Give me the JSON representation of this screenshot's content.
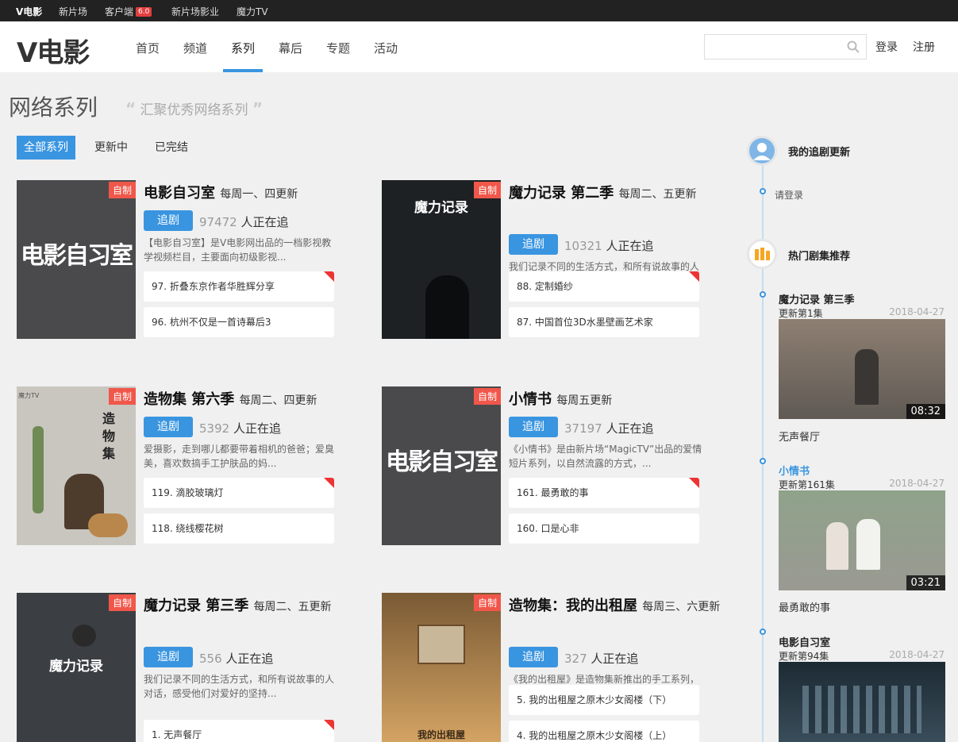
{
  "topbar": {
    "items": [
      "V电影",
      "新片场",
      "客户端",
      "新片场影业",
      "魔力TV"
    ],
    "client_badge": "6.0"
  },
  "header": {
    "logo": "V电影",
    "nav": [
      "首页",
      "频道",
      "系列",
      "幕后",
      "专题",
      "活动"
    ],
    "active_nav": "系列",
    "search_placeholder": "",
    "login": "登录",
    "register": "注册"
  },
  "page": {
    "title": "网络系列",
    "subtitle": "汇聚优秀网络系列",
    "filters": [
      "全部系列",
      "更新中",
      "已完结"
    ],
    "active_filter": "全部系列"
  },
  "cards": [
    {
      "tag": "自制",
      "title": "电影自习室",
      "schedule": "每周一、四更新",
      "follow_label": "追剧",
      "follow_count": "97472",
      "follow_suffix": "人正在追",
      "desc": "【电影自习室】是V电影网出品的一档影视教学视频栏目，主要面向初级影视...",
      "episodes": [
        "97. 折叠东京作者华胜辉分享",
        "96. 杭州不仅是一首诗幕后3"
      ],
      "thumb_label": "电影自习室",
      "thumb_bg": "#4a4a4c"
    },
    {
      "tag": "自制",
      "title": "魔力记录 第二季",
      "schedule": "每周二、五更新",
      "follow_label": "追剧",
      "follow_count": "10321",
      "follow_suffix": "人正在追",
      "desc": "我们记录不同的生活方式，和所有说故事的人",
      "episodes": [
        "88. 定制婚纱",
        "87. 中国首位3D水墨壁画艺术家"
      ],
      "thumb_label": "魔力记录",
      "thumb_bg": "#1d2124"
    },
    {
      "tag": "自制",
      "title": "造物集 第六季",
      "schedule": "每周二、四更新",
      "follow_label": "追剧",
      "follow_count": "5392",
      "follow_suffix": "人正在追",
      "desc": "爱摄影，走到哪儿都要带着相机的爸爸；爱臭美，喜欢数搞手工护肤品的妈...",
      "episodes": [
        "119. 滴胶玻璃灯",
        "118. 绕线樱花树"
      ],
      "thumb_label": "造物集",
      "thumb_bg": "#c9c6c0"
    },
    {
      "tag": "自制",
      "title": "小情书",
      "schedule": "每周五更新",
      "follow_label": "追剧",
      "follow_count": "37197",
      "follow_suffix": "人正在追",
      "desc": "《小情书》是由新片场“MagicTV”出品的爱情短片系列，以自然流露的方式，...",
      "episodes": [
        "161. 最勇敢的事",
        "160. 口是心非"
      ],
      "thumb_label": "电影自习室",
      "thumb_bg": "#4a4a4c"
    },
    {
      "tag": "自制",
      "title": "魔力记录 第三季",
      "schedule": "每周二、五更新",
      "follow_label": "追剧",
      "follow_count": "556",
      "follow_suffix": "人正在追",
      "desc": "我们记录不同的生活方式，和所有说故事的人对话，感受他们对爱好的坚持...",
      "episodes": [
        "1. 无声餐厅"
      ],
      "thumb_label": "魔力记录",
      "thumb_bg": "#3b3f44"
    },
    {
      "tag": "自制",
      "title": "造物集：我的出租屋",
      "schedule": "每周三、六更新",
      "follow_label": "追剧",
      "follow_count": "327",
      "follow_suffix": "人正在追",
      "desc": "《我的出租屋》是造物集新推出的手工系列，",
      "episodes": [
        "5. 我的出租屋之原木少女阁楼（下）",
        "4. 我的出租屋之原木少女阁楼（上）"
      ],
      "thumb_label": "我的出租屋",
      "thumb_bg": "#b6844c"
    }
  ],
  "sidebar": {
    "my_updates_title": "我的追剧更新",
    "login_hint": "请登录",
    "hot_title": "热门剧集推荐",
    "items": [
      {
        "title": "魔力记录 第三季",
        "update": "更新第1集",
        "date": "2018-04-27",
        "duration": "08:32",
        "episode": "无声餐厅",
        "highlight": false
      },
      {
        "title": "小情书",
        "update": "更新第161集",
        "date": "2018-04-27",
        "duration": "03:21",
        "episode": "最勇敢的事",
        "highlight": true
      },
      {
        "title": "电影自习室",
        "update": "更新第94集",
        "date": "2018-04-27",
        "duration": "",
        "episode": "",
        "highlight": false
      }
    ]
  },
  "colors": {
    "accent": "#3a95e0",
    "tag": "#f0574a",
    "topbar": "#222222",
    "page_bg": "#f0f0f0"
  }
}
